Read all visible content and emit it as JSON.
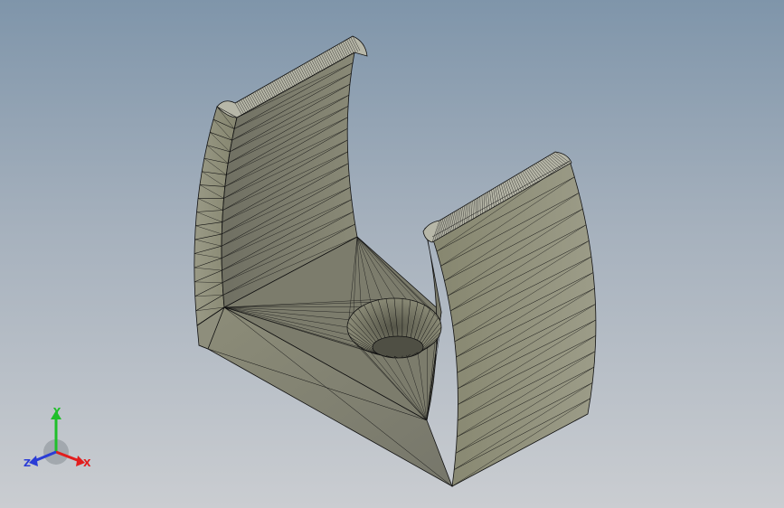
{
  "viewport": {
    "background_top": "#7f95aa",
    "background_bottom": "#cacdd1"
  },
  "model": {
    "fill_color": "#8e8e7a",
    "edge_color": "#111111"
  },
  "triad": {
    "x_label": "X",
    "y_label": "Y",
    "z_label": "Z",
    "x_color": "#e21d1d",
    "y_color": "#1fbf2a",
    "z_color": "#2a3cd6"
  }
}
